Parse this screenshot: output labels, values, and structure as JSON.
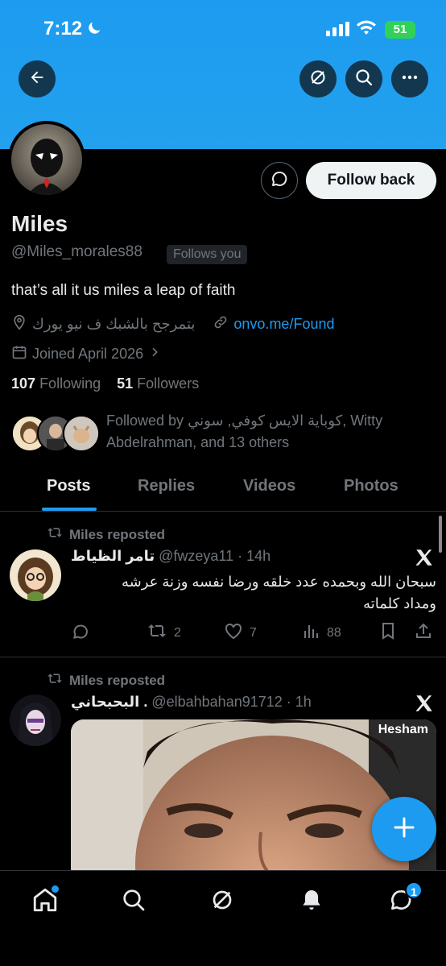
{
  "status_bar": {
    "time": "7:12",
    "battery": "51"
  },
  "header": {
    "back_icon": "arrow-left-icon",
    "grok_icon": "slash-circle-icon",
    "search_icon": "search-icon",
    "more_icon": "more-horizontal-icon",
    "banner_color": "#1d9bf0"
  },
  "profile": {
    "name": "Miles",
    "handle": "@Miles_morales88",
    "follows_you": "Follows you",
    "follow_back_label": "Follow back",
    "bio": "that’s all it us miles a leap of faith",
    "location": "بتمرجح بالشبك ف نيو يورك",
    "website": "onvo.me/Found",
    "joined": "Joined April 2026",
    "following_count": "107",
    "following_label": "Following",
    "followers_count": "51",
    "followers_label": "Followers",
    "followed_by_line1": "Followed by كوباية الايس كوفي, سوني, Witty",
    "followed_by_line2": "Abdelrahman, and 13 others"
  },
  "tabs": [
    {
      "label": "Posts",
      "active": true
    },
    {
      "label": "Replies",
      "active": false
    },
    {
      "label": "Videos",
      "active": false
    },
    {
      "label": "Photos",
      "active": false
    }
  ],
  "tweets": [
    {
      "reposted_by": "Miles reposted",
      "display_name": "تامر الظياط",
      "handle_time": "@fwzeya11 · 14h",
      "text_line1": "سبحان الله وبحمده عدد خلقه ورضا نفسه وزنة عرشه",
      "text_line2": "ومداد كلماته",
      "retweets": "2",
      "likes": "7",
      "views": "88"
    },
    {
      "reposted_by": "Miles reposted",
      "display_name": "البحبحاني .",
      "handle_time": "@elbahbahan91712 · 1h",
      "media_label": "Hesham"
    }
  ],
  "bottom_nav": {
    "home": "home-icon",
    "search": "search-icon",
    "grok": "slash-circle-icon",
    "notifications": "bell-icon",
    "messages": "chat-bubble-icon",
    "messages_badge": "1"
  },
  "colors": {
    "accent": "#1d9bf0",
    "muted": "#71767b",
    "text": "#e7e9ea",
    "battery": "#31d158"
  }
}
